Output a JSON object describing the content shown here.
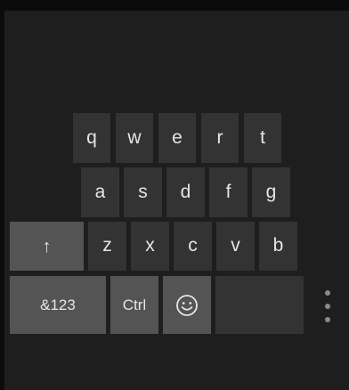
{
  "keyboard": {
    "row1": [
      "q",
      "w",
      "e",
      "r",
      "t"
    ],
    "row2": [
      "a",
      "s",
      "d",
      "f",
      "g"
    ],
    "row3": [
      "z",
      "x",
      "c",
      "v",
      "b"
    ],
    "shift_glyph": "↑",
    "symbols_label": "&123",
    "ctrl_label": "Ctrl",
    "emoji_icon": "smiley-face-icon",
    "space_label": "",
    "more_icon": "vertical-ellipsis-icon"
  },
  "colors": {
    "background": "#0b0b0b",
    "panel": "#1e1e1e",
    "key": "#333333",
    "modifier_key": "#545454",
    "text": "#e6e6e6"
  }
}
